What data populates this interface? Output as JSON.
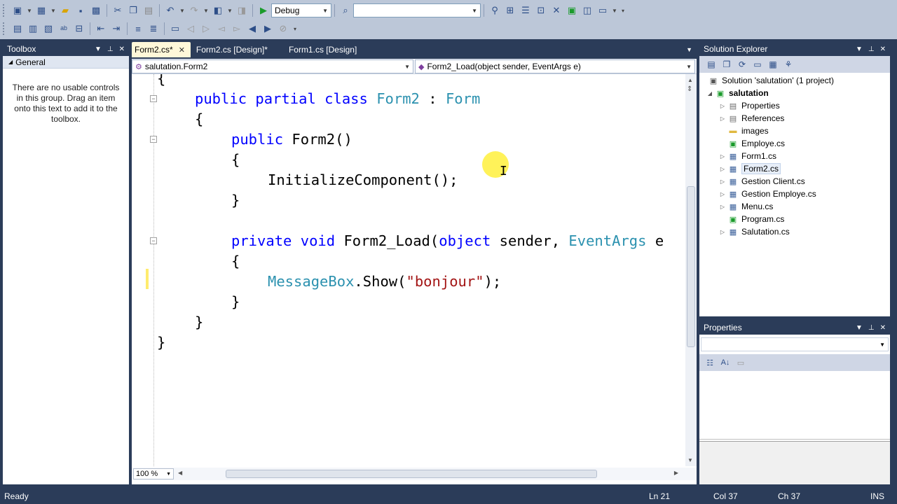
{
  "toolbar": {
    "configuration": "Debug",
    "platform": "",
    "icons_row1": [
      "new-project-icon",
      "add-item-icon",
      "open-file-icon",
      "save-icon",
      "save-all-icon",
      "cut-icon",
      "copy-icon",
      "paste-icon",
      "undo-icon",
      "redo-icon",
      "navigate-back-icon",
      "navigate-forward-icon",
      "start-debugging-icon",
      "find-in-files-icon",
      "find-icon",
      "solution-explorer-icon",
      "properties-window-icon",
      "object-browser-icon",
      "toolbox-icon",
      "start-page-icon",
      "extension-manager-icon"
    ],
    "icons_row2": [
      "comment-icon",
      "uncomment-icon",
      "indent-icon",
      "outdent-icon",
      "format-icon",
      "bookmark-icon",
      "prev-bookmark-icon",
      "next-bookmark-icon",
      "clear-bookmarks-icon"
    ]
  },
  "toolbox": {
    "title": "Toolbox",
    "group": "General",
    "empty_text": "There are no usable controls in this group. Drag an item onto this text to add it to the toolbox."
  },
  "doc_tabs": [
    {
      "label": "Form2.cs*",
      "active": true
    },
    {
      "label": "Form2.cs [Design]*",
      "active": false
    },
    {
      "label": "Form1.cs [Design]",
      "active": false
    }
  ],
  "nav": {
    "type_combo": "salutation.Form2",
    "member_combo": "Form2_Load(object sender, EventArgs e)"
  },
  "code": {
    "l1": "{",
    "l2_kw": "public partial class ",
    "l2_type": "Form2",
    "l2_sep": " : ",
    "l2_base": "Form",
    "l3": "{",
    "l4_kw": "public ",
    "l4_rest": "Form2()",
    "l5": "{",
    "l6": "InitializeComponent();",
    "l7": "}",
    "l8_kw1": "private ",
    "l8_kw2": "void ",
    "l8_name": "Form2_Load(",
    "l8_kw3": "object",
    "l8_mid": " sender, ",
    "l8_type": "EventArgs",
    "l8_end": " e",
    "l9": "{",
    "l10_type": "MessageBox",
    "l10_call": ".Show(",
    "l10_str": "\"bonjour\"",
    "l10_end": ");",
    "l11": "}",
    "l12": "}",
    "l13": "}"
  },
  "zoom": "100 %",
  "solution_explorer": {
    "title": "Solution Explorer",
    "solution": "Solution 'salutation' (1 project)",
    "project": "salutation",
    "items": [
      {
        "label": "Properties",
        "icon": "properties-folder-icon",
        "expandable": true
      },
      {
        "label": "References",
        "icon": "references-folder-icon",
        "expandable": true
      },
      {
        "label": "images",
        "icon": "folder-icon",
        "expandable": false
      },
      {
        "label": "Employe.cs",
        "icon": "cs-file-icon",
        "expandable": false
      },
      {
        "label": "Form1.cs",
        "icon": "form-file-icon",
        "expandable": true
      },
      {
        "label": "Form2.cs",
        "icon": "form-file-icon",
        "expandable": true,
        "selected": true
      },
      {
        "label": "Gestion Client.cs",
        "icon": "form-file-icon",
        "expandable": true
      },
      {
        "label": "Gestion Employe.cs",
        "icon": "form-file-icon",
        "expandable": true
      },
      {
        "label": "Menu.cs",
        "icon": "form-file-icon",
        "expandable": true
      },
      {
        "label": "Program.cs",
        "icon": "cs-file-icon",
        "expandable": false
      },
      {
        "label": "Salutation.cs",
        "icon": "form-file-icon",
        "expandable": true
      }
    ]
  },
  "properties": {
    "title": "Properties"
  },
  "status": {
    "message": "Ready",
    "line": "Ln 21",
    "col": "Col 37",
    "ch": "Ch 37",
    "mode": "INS"
  },
  "colors": {
    "chrome": "#2b3c59",
    "toolbar": "#bcc7d8",
    "keyword": "#0000ff",
    "type": "#2b91af",
    "string": "#a31515",
    "active_tab": "#fff8d9"
  }
}
